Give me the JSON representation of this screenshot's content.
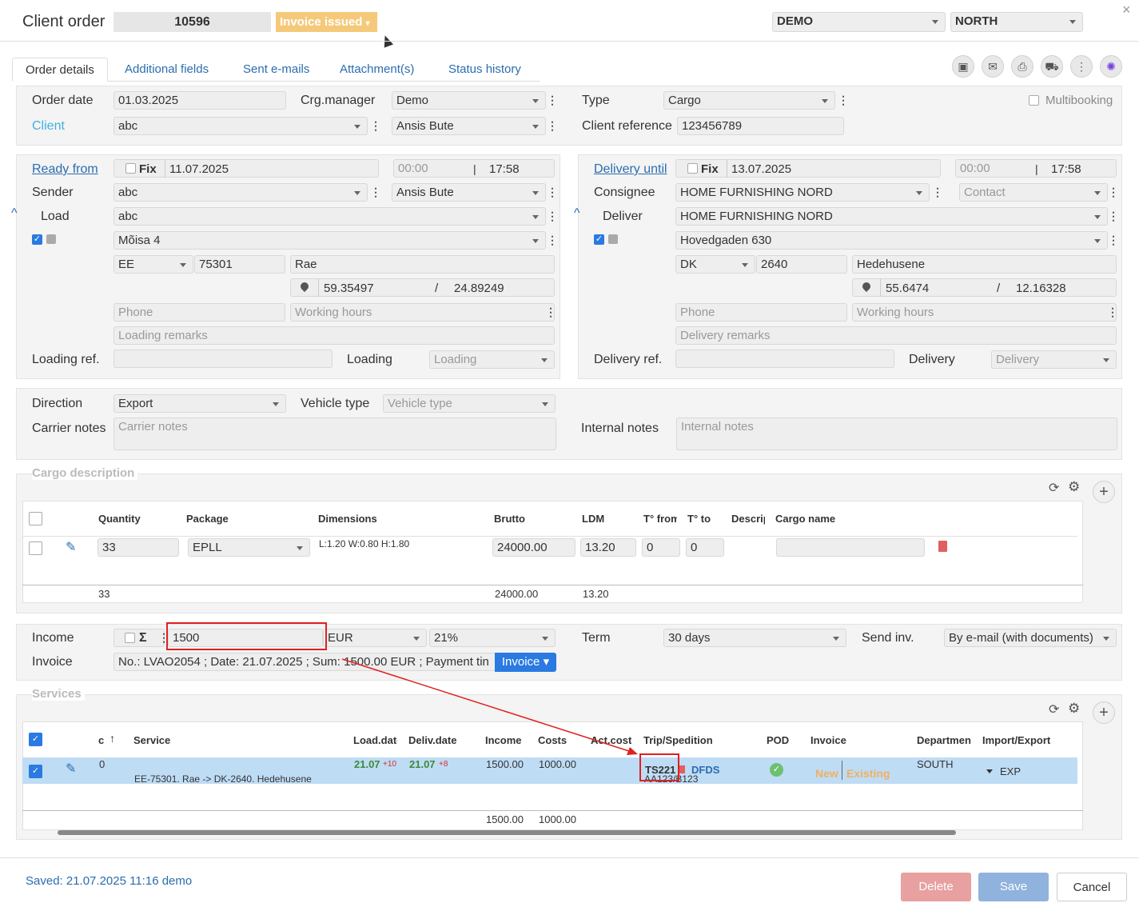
{
  "header": {
    "title": "Client order",
    "order_no": "10596",
    "status": "Invoice issued",
    "company": "DEMO",
    "region": "NORTH",
    "close": "×"
  },
  "tabs": [
    "Order details",
    "Additional fields",
    "Sent e-mails",
    "Attachment(s)",
    "Status history"
  ],
  "toolbar": {
    "icons": [
      "save-icon",
      "mail-icon",
      "print-icon",
      "road-icon",
      "more-icon",
      "ai-icon"
    ]
  },
  "top": {
    "order_date_label": "Order date",
    "order_date": "01.03.2025",
    "crg_label": "Crg.manager",
    "crg": "Demo",
    "type_label": "Type",
    "type": "Cargo",
    "multibooking": "Multibooking",
    "client_label": "Client",
    "client": "abc",
    "client_contact": "Ansis Bute",
    "client_ref_label": "Client reference",
    "client_ref": "123456789"
  },
  "loading": {
    "ready_label": "Ready from",
    "fix": "Fix",
    "date": "11.07.2025",
    "time_from": "00:00",
    "time_to": "17:58",
    "sep": "|",
    "sender_label": "Sender",
    "sender": "abc",
    "sender_contact": "Ansis Bute",
    "load_label": "Load",
    "load": "abc",
    "address": "Mõisa 4",
    "country": "EE",
    "zip": "75301",
    "city": "Rae",
    "lat": "59.35497",
    "lon": "24.89249",
    "slash": "/",
    "phone": "Phone",
    "hours": "Working hours",
    "remarks": "Loading remarks",
    "ref_label": "Loading ref.",
    "type_label": "Loading",
    "type": "Loading"
  },
  "delivery": {
    "until_label": "Delivery until",
    "fix": "Fix",
    "date": "13.07.2025",
    "time_from": "00:00",
    "time_to": "17:58",
    "sep": "|",
    "consignee_label": "Consignee",
    "consignee": "HOME FURNISHING NORD",
    "contact": "Contact",
    "deliver_label": "Deliver",
    "deliver": "HOME FURNISHING NORD",
    "address": "Hovedgaden 630",
    "country": "DK",
    "zip": "2640",
    "city": "Hedehusene",
    "lat": "55.6474",
    "lon": "12.16328",
    "slash": "/",
    "phone": "Phone",
    "hours": "Working hours",
    "remarks": "Delivery remarks",
    "ref_label": "Delivery ref.",
    "type_label": "Delivery",
    "type": "Delivery"
  },
  "notes": {
    "direction_label": "Direction",
    "direction": "Export",
    "vehicle_label": "Vehicle type",
    "vehicle": "Vehicle type",
    "carrier_label": "Carrier notes",
    "carrier": "Carrier notes",
    "internal_label": "Internal notes",
    "internal": "Internal notes"
  },
  "cargo": {
    "title": "Cargo description",
    "headers": [
      "Quantity",
      "Package",
      "Dimensions",
      "Brutto",
      "LDM",
      "T° from",
      "T° to",
      "Descrip",
      "Cargo name"
    ],
    "row": {
      "qty": "33",
      "package": "EPLL",
      "dims": "L:1.20 W:0.80 H:1.80",
      "brutto": "24000.00",
      "ldm": "13.20",
      "tfrom": "0",
      "tto": "0"
    },
    "totals": {
      "qty": "33",
      "brutto": "24000.00",
      "ldm": "13.20"
    }
  },
  "income": {
    "label": "Income",
    "sigma": "Σ",
    "value": "1500",
    "currency": "EUR",
    "vat": "21%",
    "term_label": "Term",
    "term": "30 days",
    "send_label": "Send inv.",
    "send": "By e-mail (with documents)",
    "invoice_label": "Invoice",
    "invoice": "No.: LVAO2054 ; Date: 21.07.2025 ; Sum: 1500.00 EUR ; Payment tin",
    "invoice_btn": "Invoice ▾"
  },
  "services": {
    "title": "Services",
    "headers": [
      "c",
      "Service",
      "Load.date",
      "Deliv.date",
      "Income",
      "Costs",
      "Act.costs",
      "Trip/Spedition",
      "POD",
      "Invoice",
      "Department",
      "Import/Export"
    ],
    "row": {
      "c": "0",
      "service": "EE-75301. Rae -> DK-2640. Hedehusene",
      "load": "21.07",
      "load_off": "+10",
      "deliv": "21.07",
      "deliv_off": "+8",
      "income": "1500.00",
      "costs": "1000.00",
      "trip": "TS221",
      "carrier": "DFDS",
      "plates": "AA123/B123",
      "inv_new": "New",
      "inv_exist": "Existing",
      "dept": "SOUTH",
      "ie": "EXP"
    },
    "totals": {
      "income": "1500.00",
      "costs": "1000.00"
    }
  },
  "footer": {
    "saved": "Saved: 21.07.2025 11:16 demo",
    "delete": "Delete",
    "save": "Save",
    "cancel": "Cancel"
  },
  "colors": {
    "link": "#2a6db0",
    "status": "#f5c97a",
    "delete": "#e8a0a0",
    "save": "#8fb3dc",
    "highlight": "#bfdcf5",
    "annotation": "#e02020"
  }
}
